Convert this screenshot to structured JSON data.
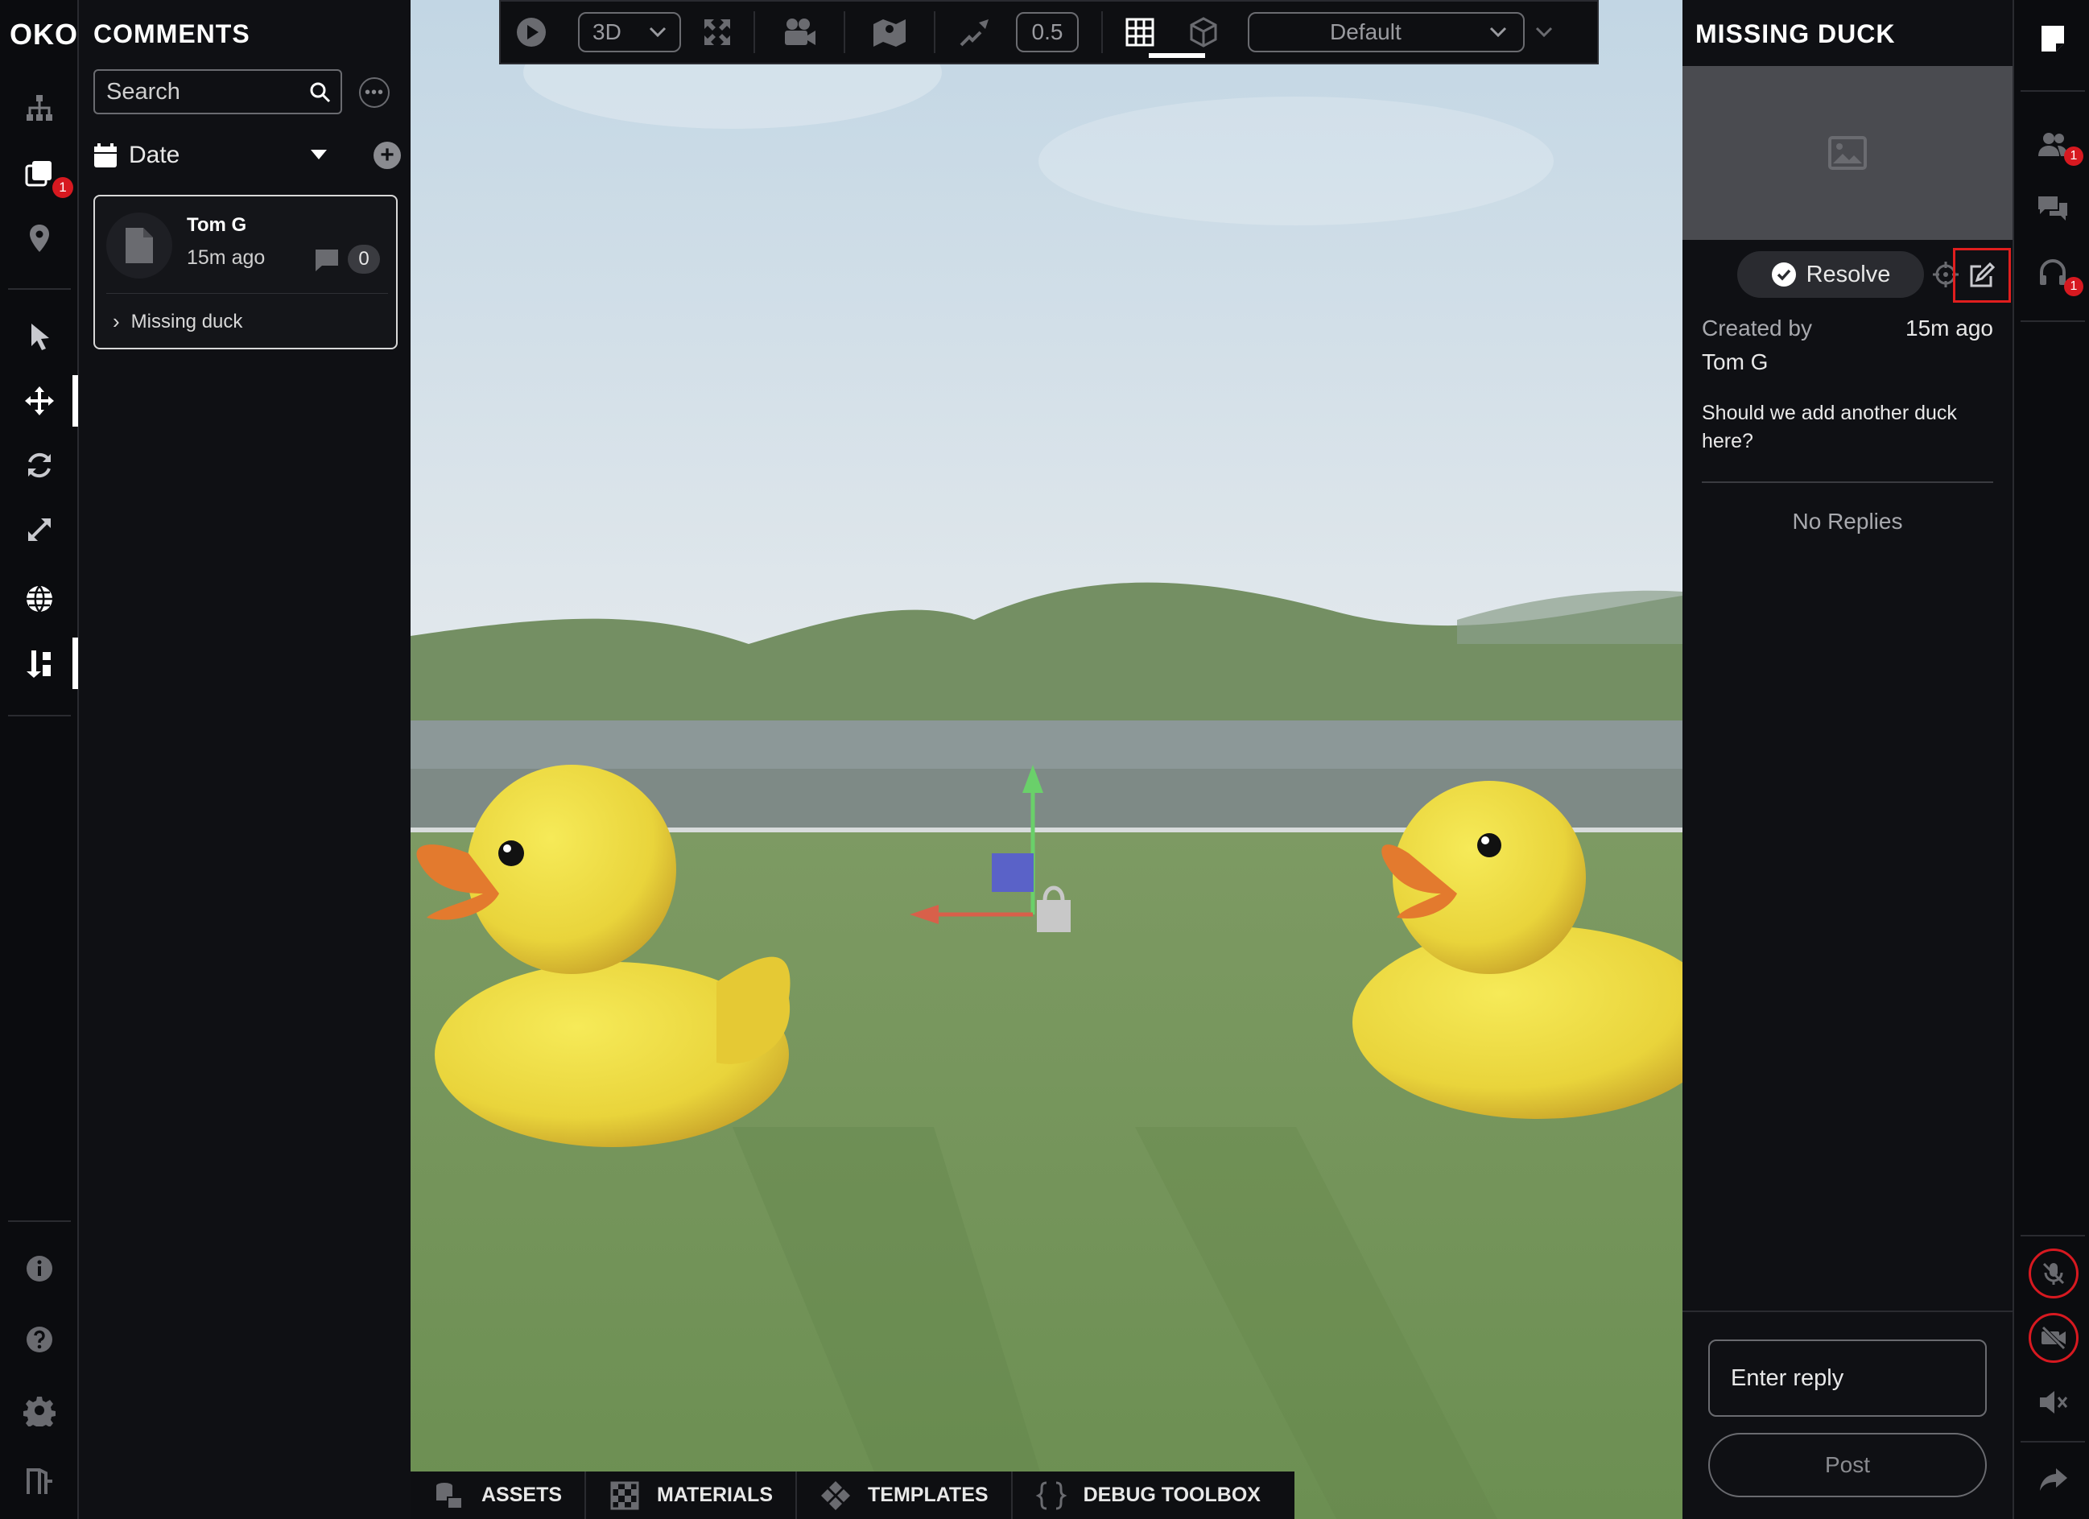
{
  "app": {
    "logo": "OKO"
  },
  "left_rail": {
    "items": [
      {
        "name": "hierarchy",
        "icon": "hierarchy-icon"
      },
      {
        "name": "comments",
        "icon": "comments-stack-icon",
        "badge": "1"
      },
      {
        "name": "locations",
        "icon": "map-pin-icon"
      },
      {
        "name": "select",
        "icon": "cursor-icon"
      },
      {
        "name": "move",
        "icon": "move-icon"
      },
      {
        "name": "rotate",
        "icon": "rotate-icon"
      },
      {
        "name": "scale",
        "icon": "scale-icon"
      },
      {
        "name": "world",
        "icon": "globe-icon"
      },
      {
        "name": "snap",
        "icon": "snap-icon"
      },
      {
        "name": "info",
        "icon": "info-icon"
      },
      {
        "name": "help",
        "icon": "help-icon"
      },
      {
        "name": "settings",
        "icon": "gear-icon"
      },
      {
        "name": "exit",
        "icon": "exit-icon"
      }
    ]
  },
  "comments_panel": {
    "title": "COMMENTS",
    "search": {
      "placeholder": "Search",
      "value": ""
    },
    "sort": {
      "label": "Date"
    },
    "cards": [
      {
        "author": "Tom G",
        "time": "15m ago",
        "reply_count": "0",
        "subject": "Missing duck"
      }
    ]
  },
  "toolbar": {
    "view_mode": "3D",
    "snap_value": "0.5",
    "camera_preset": "Default"
  },
  "bottom_bar": {
    "items": [
      "ASSETS",
      "MATERIALS",
      "TEMPLATES",
      "DEBUG TOOLBOX"
    ]
  },
  "detail_panel": {
    "title": "MISSING DUCK",
    "resolve_label": "Resolve",
    "created_by_label": "Created by",
    "creator": "Tom G",
    "created_time": "15m ago",
    "comment": "Should we add another duck here?",
    "no_replies": "No Replies",
    "reply_placeholder": "Enter reply",
    "post_label": "Post"
  },
  "right_rail": {
    "badges": {
      "users": "1",
      "audio": "1"
    }
  },
  "colors": {
    "accent_red": "#d71920",
    "panel_bg": "#0f1014",
    "rail_bg": "#0b0c0f"
  }
}
